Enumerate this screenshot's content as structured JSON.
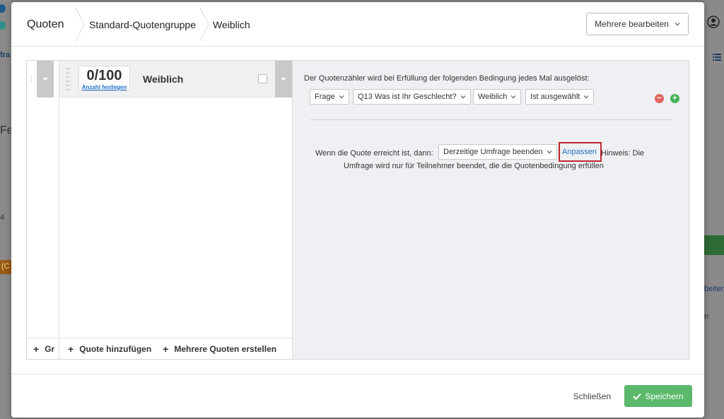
{
  "breadcrumb": [
    "Quoten",
    "Standard-Quotengruppe",
    "Weiblich"
  ],
  "edit_multiple_label": "Mehrere bearbeiten",
  "background": {
    "left_text_1": "fra",
    "left_text_2": "Fe",
    "left_text_3": "4",
    "left_text_4": "(C",
    "right_text_1": "beiten",
    "right_text_2": "n"
  },
  "quota": {
    "count": "0/100",
    "set_count_link": "Anzahl festlegen",
    "name": "Weiblich"
  },
  "left_footer": {
    "group_add": "Gr",
    "add_quota": "Quote hinzufügen",
    "add_multiple": "Mehrere Quoten erstellen"
  },
  "condition": {
    "intro": "Der Quotenzähler wird bei Erfüllung der folgenden Bedingung jedes Mal ausgelöst:",
    "selects": [
      "Frage",
      "Q13 Was ist Ihr Geschlecht?",
      "Weiblich",
      "Ist ausgewählt"
    ]
  },
  "action": {
    "label": "Wenn die Quote erreicht ist, dann:",
    "selected": "Derzeitige Umfrage beenden",
    "customize_link": "Anpassen",
    "hint_line1": "Hinweis: Die",
    "hint_line2": "Umfrage wird nur für Teilnehmer beendet, die die Quotenbedingung erfüllen"
  },
  "footer": {
    "close_label": "Schließen",
    "save_label": "Speichern"
  },
  "colors": {
    "save_green": "#5cb86a",
    "link_blue": "#1f6fc4",
    "highlight_red": "#c0262d",
    "remove_red": "#e0645f",
    "add_green": "#45b357"
  }
}
